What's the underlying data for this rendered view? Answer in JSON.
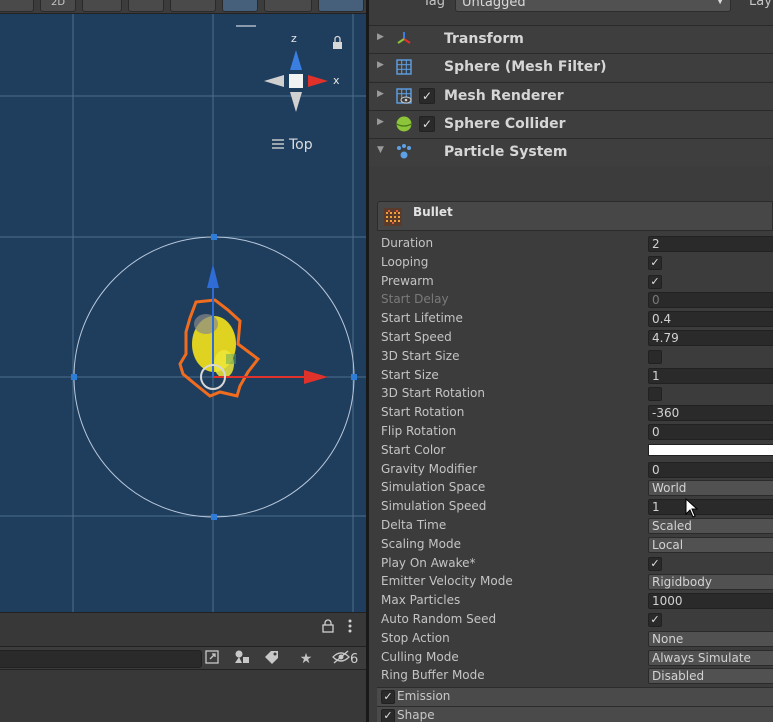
{
  "scene": {
    "toolbar": {
      "mode_2d_label": "2D",
      "gizmos_icon": "gizmo-icon"
    },
    "gizmo": {
      "axis_z_label": "z",
      "axis_x_label": "x",
      "view_label": "Top",
      "lock_icon": "lock-icon",
      "menu_icon": "hamburger-icon"
    },
    "hierarchy": {
      "hidden_count": "6",
      "lock_icon": "lock-icon",
      "more_icon": "kebab-icon"
    }
  },
  "inspector": {
    "tag_label": "Tag",
    "tag_value": "Untagged",
    "layer_label": "Lay",
    "components": [
      {
        "name": "Transform",
        "icon": "transform-icon",
        "has_check": false
      },
      {
        "name": "Sphere (Mesh Filter)",
        "icon": "mesh-filter-icon",
        "has_check": false
      },
      {
        "name": "Mesh Renderer",
        "icon": "mesh-renderer-icon",
        "has_check": true,
        "checked": true
      },
      {
        "name": "Sphere Collider",
        "icon": "sphere-collider-icon",
        "has_check": true,
        "checked": true
      },
      {
        "name": "Particle System",
        "icon": "particle-system-icon",
        "has_check": false,
        "expanded": true
      }
    ],
    "particle_system": {
      "name": "Bullet",
      "properties": [
        {
          "label": "Duration",
          "type": "field",
          "value": "2"
        },
        {
          "label": "Looping",
          "type": "check",
          "checked": true
        },
        {
          "label": "Prewarm",
          "type": "check",
          "checked": true
        },
        {
          "label": "Start Delay",
          "type": "field",
          "value": "0",
          "disabled": true
        },
        {
          "label": "Start Lifetime",
          "type": "field",
          "value": "0.4"
        },
        {
          "label": "Start Speed",
          "type": "field",
          "value": "4.79"
        },
        {
          "label": "3D Start Size",
          "type": "check",
          "checked": false
        },
        {
          "label": "Start Size",
          "type": "field",
          "value": "1"
        },
        {
          "label": "3D Start Rotation",
          "type": "check",
          "checked": false
        },
        {
          "label": "Start Rotation",
          "type": "field",
          "value": "-360"
        },
        {
          "label": "Flip Rotation",
          "type": "field",
          "value": "0"
        },
        {
          "label": "Start Color",
          "type": "color",
          "value": "#ffffff"
        },
        {
          "label": "Gravity Modifier",
          "type": "field",
          "value": "0"
        },
        {
          "label": "Simulation Space",
          "type": "dropdown",
          "value": "World"
        },
        {
          "label": "Simulation Speed",
          "type": "field",
          "value": "1"
        },
        {
          "label": "Delta Time",
          "type": "dropdown",
          "value": "Scaled"
        },
        {
          "label": "Scaling Mode",
          "type": "dropdown",
          "value": "Local"
        },
        {
          "label": "Play On Awake*",
          "type": "check",
          "checked": true
        },
        {
          "label": "Emitter Velocity Mode",
          "type": "dropdown",
          "value": "Rigidbody"
        },
        {
          "label": "Max Particles",
          "type": "field",
          "value": "1000"
        },
        {
          "label": "Auto Random Seed",
          "type": "check",
          "checked": true
        },
        {
          "label": "Stop Action",
          "type": "dropdown",
          "value": "None"
        },
        {
          "label": "Culling Mode",
          "type": "dropdown",
          "value": "Always Simulate"
        },
        {
          "label": "Ring Buffer Mode",
          "type": "dropdown",
          "value": "Disabled"
        }
      ],
      "modules": [
        {
          "label": "Emission",
          "checked": true
        },
        {
          "label": "Shape",
          "checked": true
        }
      ]
    }
  },
  "colors": {
    "viewport_bg": "#1f3e5e",
    "axis_x": "#e0322a",
    "axis_y": "#2f6cd6",
    "selection_outline": "#f26c1e",
    "particle": "#f4e21a"
  }
}
